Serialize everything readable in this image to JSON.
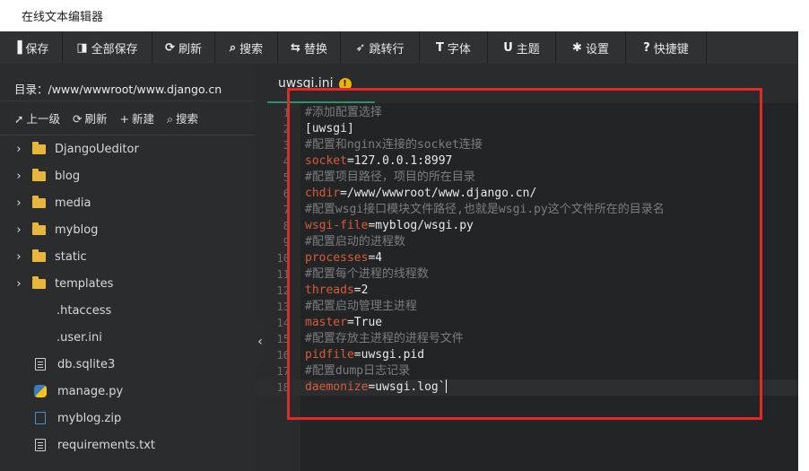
{
  "window_title": "在线文本编辑器",
  "toolbar": [
    {
      "icon": "save-icon",
      "glyph": "▐",
      "label": "保存",
      "width": 70
    },
    {
      "icon": "save-all-icon",
      "glyph": "◨",
      "label": "全部保存",
      "width": 100
    },
    {
      "icon": "refresh-icon",
      "glyph": "⟳",
      "label": "刷新",
      "width": 70
    },
    {
      "icon": "search-icon",
      "glyph": "⌕",
      "label": "搜索",
      "width": 70
    },
    {
      "icon": "replace-icon",
      "glyph": "⇆",
      "label": "替换",
      "width": 70
    },
    {
      "icon": "goto-line-icon",
      "glyph": "➶",
      "label": "跳转行",
      "width": 88
    },
    {
      "icon": "font-icon",
      "glyph": "T",
      "label": "字体",
      "width": 76
    },
    {
      "icon": "theme-icon",
      "glyph": "U",
      "label": "主题",
      "width": 76
    },
    {
      "icon": "settings-icon",
      "glyph": "✱",
      "label": "设置",
      "width": 78
    },
    {
      "icon": "shortcut-icon",
      "glyph": "?",
      "label": "快捷键",
      "width": 90
    }
  ],
  "sidebar": {
    "dir_label": "目录：/www/wwwroot/www.django.cn",
    "actions": [
      {
        "icon": "arrow-up-icon",
        "glyph": "➚",
        "label": "上一级"
      },
      {
        "icon": "refresh-icon",
        "glyph": "⟳",
        "label": "刷新"
      },
      {
        "icon": "plus-icon",
        "glyph": "+",
        "label": "新建"
      },
      {
        "icon": "search-icon",
        "glyph": "⌕",
        "label": "搜索"
      }
    ],
    "items": [
      {
        "type": "folder",
        "name": "DjangoUeditor"
      },
      {
        "type": "folder",
        "name": "blog"
      },
      {
        "type": "folder",
        "name": "media"
      },
      {
        "type": "folder",
        "name": "myblog"
      },
      {
        "type": "folder",
        "name": "static"
      },
      {
        "type": "folder",
        "name": "templates"
      },
      {
        "type": "plain",
        "name": ".htaccess"
      },
      {
        "type": "plain",
        "name": ".user.ini"
      },
      {
        "type": "file",
        "name": "db.sqlite3"
      },
      {
        "type": "python",
        "name": "manage.py"
      },
      {
        "type": "zip",
        "name": "myblog.zip"
      },
      {
        "type": "file",
        "name": "requirements.txt"
      }
    ]
  },
  "editor": {
    "tab_label": "uwsgi.ini",
    "tab_warning": "!",
    "lines": [
      {
        "n": "1",
        "parts": [
          {
            "c": "comment",
            "t": "#添加配置选择"
          }
        ]
      },
      {
        "n": "2",
        "parts": [
          {
            "c": "val",
            "t": "[uwsgi]"
          }
        ]
      },
      {
        "n": "3",
        "parts": [
          {
            "c": "comment",
            "t": "#配置和nginx连接的socket连接"
          }
        ]
      },
      {
        "n": "4",
        "parts": [
          {
            "c": "key",
            "t": "socket"
          },
          {
            "c": "val",
            "t": "=127.0.0.1:8997"
          }
        ]
      },
      {
        "n": "5",
        "parts": [
          {
            "c": "comment",
            "t": "#配置项目路径，项目的所在目录"
          }
        ]
      },
      {
        "n": "6",
        "parts": [
          {
            "c": "key",
            "t": "chdir"
          },
          {
            "c": "val",
            "t": "=/www/wwwroot/www.django.cn/"
          }
        ]
      },
      {
        "n": "7",
        "parts": [
          {
            "c": "comment",
            "t": "#配置wsgi接口模块文件路径,也就是wsgi.py这个文件所在的目录名"
          }
        ]
      },
      {
        "n": "8",
        "parts": [
          {
            "c": "key",
            "t": "wsgi-file"
          },
          {
            "c": "val",
            "t": "=myblog/wsgi.py"
          }
        ]
      },
      {
        "n": "9",
        "parts": [
          {
            "c": "comment",
            "t": "#配置启动的进程数"
          }
        ]
      },
      {
        "n": "10",
        "parts": [
          {
            "c": "key",
            "t": "processes"
          },
          {
            "c": "val",
            "t": "=4"
          }
        ]
      },
      {
        "n": "11",
        "parts": [
          {
            "c": "comment",
            "t": "#配置每个进程的线程数"
          }
        ]
      },
      {
        "n": "12",
        "parts": [
          {
            "c": "key",
            "t": "threads"
          },
          {
            "c": "val",
            "t": "=2"
          }
        ]
      },
      {
        "n": "13",
        "parts": [
          {
            "c": "comment",
            "t": "#配置启动管理主进程"
          }
        ]
      },
      {
        "n": "14",
        "parts": [
          {
            "c": "key",
            "t": "master"
          },
          {
            "c": "val",
            "t": "=True"
          }
        ]
      },
      {
        "n": "15",
        "parts": [
          {
            "c": "comment",
            "t": "#配置存放主进程的进程号文件"
          }
        ]
      },
      {
        "n": "16",
        "parts": [
          {
            "c": "key",
            "t": "pidfile"
          },
          {
            "c": "val",
            "t": "=uwsgi.pid"
          }
        ]
      },
      {
        "n": "17",
        "parts": [
          {
            "c": "comment",
            "t": "#配置dump日志记录"
          }
        ]
      },
      {
        "n": "18",
        "parts": [
          {
            "c": "key",
            "t": "daemonize"
          },
          {
            "c": "val",
            "t": "=uwsgi.log`"
          }
        ],
        "current": true
      }
    ]
  },
  "collapse_glyph": "‹",
  "colors": {
    "toolbar_bg": "#2f3133",
    "sidebar_bg": "#2b2c2d",
    "editor_bg": "#232425",
    "key": "#d65b3c",
    "comment": "#7a7d80",
    "highlight_box": "#e02a2a",
    "folder": "#e8b63a"
  }
}
